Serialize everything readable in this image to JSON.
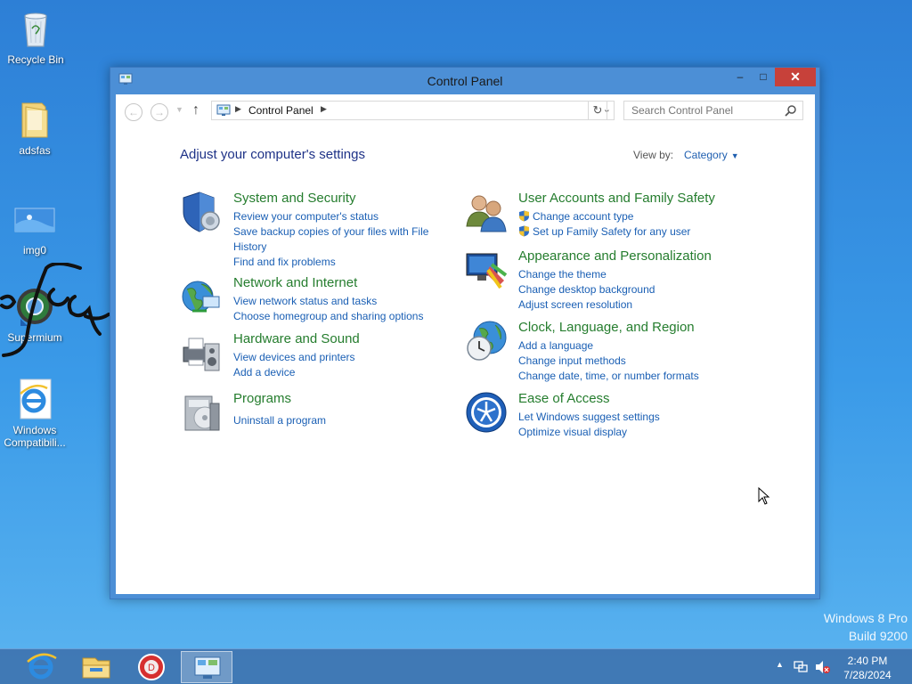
{
  "desktop": {
    "icons": [
      {
        "label": "Recycle Bin",
        "icon": "recycle-bin-icon"
      },
      {
        "label": "adsfas",
        "icon": "folder-icon"
      },
      {
        "label": "img0",
        "icon": "image-file-icon"
      },
      {
        "label": "Supermium",
        "icon": "supermium-browser-icon"
      },
      {
        "label": "Windows Compatibili...",
        "icon": "internet-explorer-icon"
      }
    ],
    "watermark_line1": "Windows 8 Pro",
    "watermark_line2": "Build 9200"
  },
  "window": {
    "title": "Control Panel",
    "controls": {
      "minimize": "–",
      "maximize": "□",
      "close": "✕"
    },
    "address": {
      "crumb": "Control Panel"
    },
    "search": {
      "placeholder": "Search Control Panel",
      "value": ""
    },
    "heading": "Adjust your computer's settings",
    "view_by_label": "View by:",
    "view_by_value": "Category",
    "categories": [
      {
        "title": "System and Security",
        "icon": "shield-security-icon",
        "links": [
          "Review your computer's status",
          "Save backup copies of your files with File History",
          "Find and fix problems"
        ]
      },
      {
        "title": "Network and Internet",
        "icon": "network-globe-icon",
        "links": [
          "View network status and tasks",
          "Choose homegroup and sharing options"
        ]
      },
      {
        "title": "Hardware and Sound",
        "icon": "printer-speaker-icon",
        "links": [
          "View devices and printers",
          "Add a device"
        ]
      },
      {
        "title": "Programs",
        "icon": "programs-disc-icon",
        "links": [
          "Uninstall a program"
        ]
      },
      {
        "title": "User Accounts and Family Safety",
        "icon": "users-icon",
        "links": [
          "Change account type",
          "Set up Family Safety for any user"
        ]
      },
      {
        "title": "Appearance and Personalization",
        "icon": "monitor-paint-icon",
        "links": [
          "Change the theme",
          "Change desktop background",
          "Adjust screen resolution"
        ]
      },
      {
        "title": "Clock, Language, and Region",
        "icon": "clock-globe-icon",
        "links": [
          "Add a language",
          "Change input methods",
          "Change date, time, or number formats"
        ]
      },
      {
        "title": "Ease of Access",
        "icon": "ease-of-access-icon",
        "links": [
          "Let Windows suggest settings",
          "Optimize visual display"
        ]
      }
    ]
  },
  "taskbar": {
    "items": [
      {
        "icon": "internet-explorer-icon"
      },
      {
        "icon": "file-explorer-icon"
      },
      {
        "icon": "red-app-icon"
      },
      {
        "icon": "control-panel-icon"
      }
    ],
    "time": "2:40 PM",
    "date": "7/28/2024"
  },
  "colors": {
    "desktop": "#2f8ce0",
    "category_title": "#257d2e",
    "link": "#1a5fb4",
    "heading": "#1e3287",
    "close_button": "#c7413a"
  }
}
